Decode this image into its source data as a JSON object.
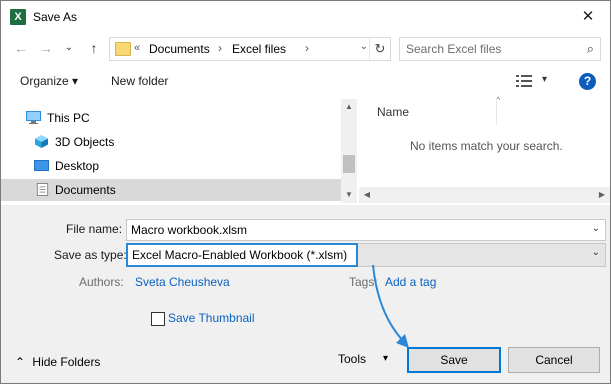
{
  "window": {
    "title": "Save As",
    "app_icon": "excel-icon",
    "app_icon_text": "X",
    "close_glyph": "✕"
  },
  "nav": {
    "back_glyph": "←",
    "forward_glyph": "→",
    "recent_glyph": "⌄",
    "up_glyph": "↑",
    "address_chevron": "«",
    "breadcrumbs": [
      "Documents",
      "Excel files"
    ],
    "crumb_separator": "›",
    "address_dropdown_glyph": "⌄",
    "refresh_glyph": "↻",
    "search_placeholder": "Search Excel files",
    "search_glyph": "⌕"
  },
  "toolbar": {
    "organize_label": "Organize ▾",
    "new_folder_label": "New folder",
    "view_dropdown_glyph": "▾",
    "help_label": "?"
  },
  "nav_pane": {
    "items": [
      {
        "label": "This PC",
        "icon": "pc-icon",
        "selected": false
      },
      {
        "label": "3D Objects",
        "icon": "3d-objects-icon",
        "selected": false
      },
      {
        "label": "Desktop",
        "icon": "desktop-icon",
        "selected": false
      },
      {
        "label": "Documents",
        "icon": "documents-icon",
        "selected": true
      }
    ],
    "scroll_up": "▲",
    "scroll_down": "▼"
  },
  "list_pane": {
    "column_name": "Name",
    "sort_indicator": "^",
    "empty_message": "No items match your search.",
    "scroll_left": "◀",
    "scroll_right": "▶"
  },
  "form": {
    "file_name_label": "File name:",
    "file_name_value": "Macro workbook.xlsm",
    "save_type_label": "Save as type:",
    "save_type_value": "Excel Macro-Enabled Workbook (*.xlsm)",
    "dropdown_glyph": "⌄",
    "authors_label": "Authors:",
    "authors_value": "Sveta Cheusheva",
    "tags_label": "Tags:",
    "tags_value": "Add a tag",
    "thumbnail_label": "Save Thumbnail",
    "thumbnail_checked": false,
    "hide_folders_label": "Hide Folders",
    "hide_folders_glyph": "⌃",
    "tools_label": "Tools",
    "tools_glyph": "▾",
    "save_label": "Save",
    "cancel_label": "Cancel"
  },
  "colors": {
    "accent": "#0078d7",
    "excel_green": "#1d6f42",
    "link": "#0b62c0",
    "arrow": "#2b88d8"
  }
}
